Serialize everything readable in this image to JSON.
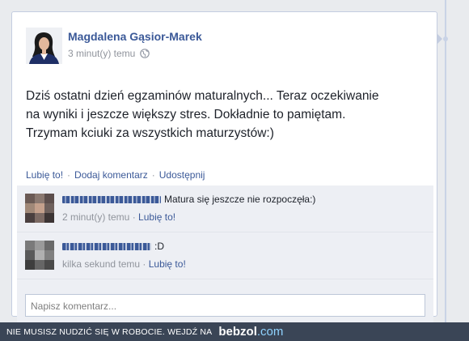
{
  "post": {
    "author": "Magdalena Gąsior-Marek",
    "time": "3 minut(y) temu",
    "privacy_icon": "globe-icon",
    "text_lines": [
      "Dziś ostatni dzień egzaminów maturalnych... Teraz oczekiwanie",
      "na wyniki i jeszcze większy stres. Dokładnie to pamiętam.",
      "Trzymam kciuki za wszystkich maturzystów:)"
    ]
  },
  "actions": {
    "like": "Lubię to!",
    "comment": "Dodaj komentarz",
    "share": "Udostępnij",
    "separator": "·"
  },
  "comments": [
    {
      "text": "Matura się jeszcze nie rozpoczęła:)",
      "time": "2 minut(y) temu",
      "like": "Lubię to!"
    },
    {
      "text": ":D",
      "time": "kilka sekund temu",
      "like": "Lubię to!"
    }
  ],
  "reply": {
    "placeholder": "Napisz komentarz..."
  },
  "banner": {
    "text": "NIE MUSISZ NUDZIĆ SIĘ W ROBOCIE. WEJDŹ NA",
    "logo": "bebzol",
    "logo_suffix": ".com"
  },
  "colors": {
    "link": "#3b5998",
    "banner_bg": "#3a4556"
  }
}
